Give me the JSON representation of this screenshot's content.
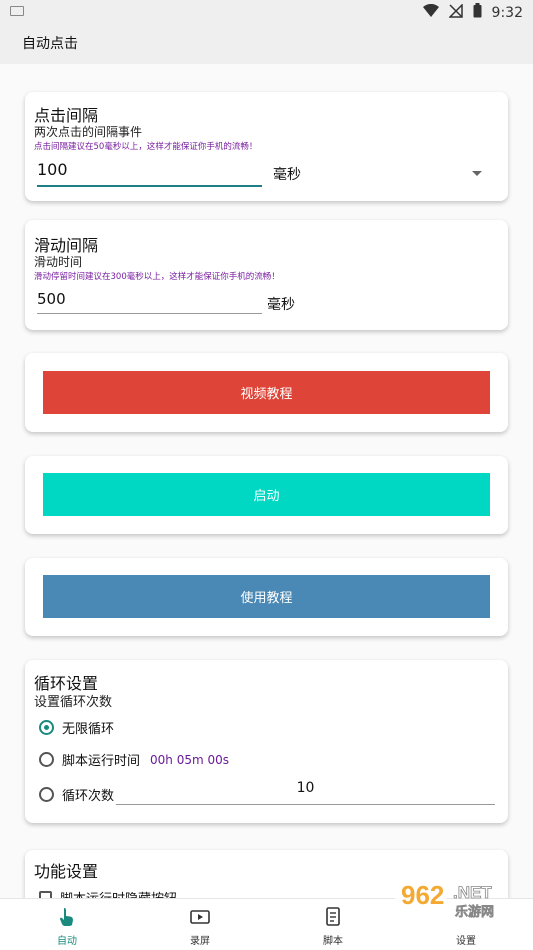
{
  "status": {
    "time": "9:32"
  },
  "appbar": {
    "title": "自动点击"
  },
  "click_interval": {
    "title": "点击间隔",
    "subtitle": "两次点击的间隔事件",
    "hint": "点击间隔建议在50毫秒以上，这样才能保证你手机的流畅！",
    "value": "100",
    "unit": "毫秒"
  },
  "slide_interval": {
    "title": "滑动间隔",
    "subtitle": "滑动时间",
    "hint": "滑动停留时间建议在300毫秒以上，这样才能保证你手机的流畅！",
    "value": "500",
    "unit": "毫秒"
  },
  "buttons": {
    "video_tutorial": "视频教程",
    "start": "启动",
    "usage_tutorial": "使用教程"
  },
  "loop": {
    "title": "循环设置",
    "subtitle": "设置循环次数",
    "option_infinite": "无限循环",
    "option_runtime": "脚本运行时间",
    "runtime_value": "00h 05m 00s",
    "option_count": "循环次数",
    "count_value": "10",
    "selected": "无限循环"
  },
  "function": {
    "title": "功能设置",
    "hide_button_label": "脚本运行时隐藏按钮"
  },
  "nav": {
    "auto": "自动",
    "record": "录屏",
    "script": "脚本",
    "settings": "设置"
  },
  "watermark": {
    "brand": "962",
    "suffix": ".NET",
    "sub": "乐游网"
  },
  "colors": {
    "video_btn": "#de4437",
    "start_btn": "#00d8c4",
    "usage_btn": "#4a88b5",
    "accent": "#1a8a7e",
    "hint": "#7a1fa2"
  }
}
